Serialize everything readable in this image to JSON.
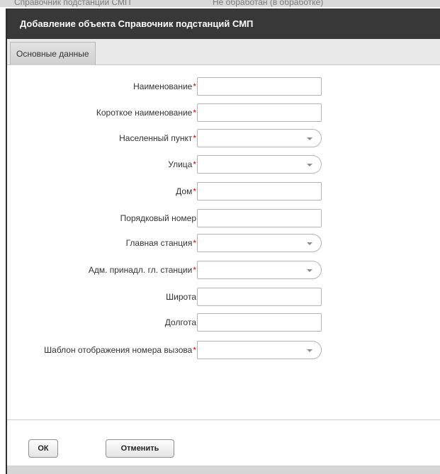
{
  "background": {
    "partial_text_left": "Справочник подстанций СМП",
    "partial_text_right": "Не обработан (в обработке)"
  },
  "dialog": {
    "title": "Добавление объекта Справочник подстанций СМП",
    "tab_label": "Основные данные",
    "required_mark": "*",
    "fields": [
      {
        "label": "Наименование",
        "required": true,
        "type": "text",
        "value": ""
      },
      {
        "label": "Короткое наименование",
        "required": true,
        "type": "text",
        "value": ""
      },
      {
        "label": "Населенный пункт",
        "required": true,
        "type": "select",
        "value": ""
      },
      {
        "label": "Улица",
        "required": true,
        "type": "select",
        "value": ""
      },
      {
        "label": "Дом",
        "required": true,
        "type": "text",
        "value": ""
      },
      {
        "label": "Порядковый номер",
        "required": false,
        "type": "text",
        "value": ""
      },
      {
        "label": "Главная станция",
        "required": true,
        "type": "select",
        "value": ""
      },
      {
        "label": "Адм. принадл. гл. станции",
        "required": true,
        "type": "select",
        "value": ""
      },
      {
        "label": "Широта",
        "required": false,
        "type": "text",
        "value": ""
      },
      {
        "label": "Долгота",
        "required": false,
        "type": "text",
        "value": ""
      },
      {
        "label": "Шаблон отображения номера вызова",
        "required": true,
        "type": "select",
        "value": ""
      }
    ],
    "ok_label": "ОК",
    "cancel_label": "Отменить"
  },
  "colors": {
    "title_bar": "#383838",
    "required_mark": "#d40000"
  }
}
